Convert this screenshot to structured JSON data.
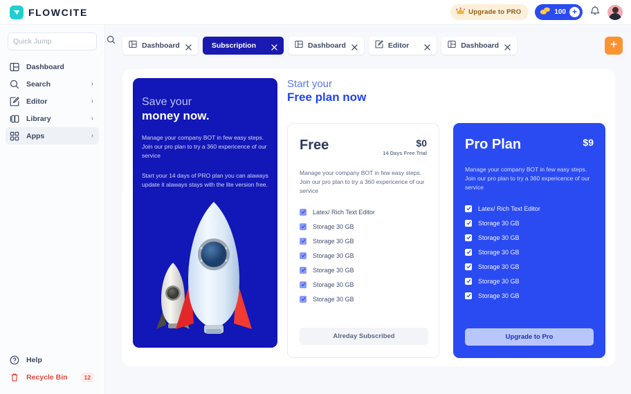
{
  "app": {
    "logo_text": "FLOWCITE",
    "logo_icon": "flowcite-logo-icon"
  },
  "topbar": {
    "upgrade_pill": {
      "label": "Upgrade to PRO",
      "icon": "crown-icon"
    },
    "coins_pill": {
      "count": "100",
      "icon": "coins-icon",
      "plus": "+"
    },
    "notifications_icon": "bell-icon",
    "avatar": "user-avatar"
  },
  "sidebar": {
    "search": {
      "placeholder": "Quick Jump",
      "value": "",
      "icon": "search-icon"
    },
    "items": [
      {
        "label": "Dashboard",
        "icon": "dashboard-icon",
        "chevron": "",
        "active": false
      },
      {
        "label": "Search",
        "icon": "search-icon",
        "chevron": "›",
        "active": false
      },
      {
        "label": "Editor",
        "icon": "editor-icon",
        "chevron": "›",
        "active": false
      },
      {
        "label": "Library",
        "icon": "library-icon",
        "chevron": "›",
        "active": false
      },
      {
        "label": "Apps",
        "icon": "apps-icon",
        "chevron": "›",
        "active": true
      }
    ],
    "bottom": [
      {
        "label": "Help",
        "icon": "help-circle-icon",
        "badge": ""
      },
      {
        "label": "Recycle Bin",
        "icon": "trash-icon",
        "badge": "12"
      }
    ]
  },
  "tabs": {
    "items": [
      {
        "label": "Dashboard",
        "icon": "dashboard-icon",
        "active": false
      },
      {
        "label": "Subscription",
        "icon": "",
        "active": true
      },
      {
        "label": "Dashboard",
        "icon": "dashboard-icon",
        "active": false
      },
      {
        "label": "Editor",
        "icon": "editor-icon",
        "active": false
      },
      {
        "label": "Dashboard",
        "icon": "dashboard-icon",
        "active": false
      }
    ],
    "close_icon": "close-icon",
    "add_tab": {
      "icon": "plus-icon",
      "color": "#fb9332"
    }
  },
  "promo": {
    "subtitle": "Save your",
    "title": "money now.",
    "paragraph1": "Manage your company BOT in few easy steps. Join our pro plan to try a 360 expericence of our service",
    "paragraph2": "Start your 14 days of PRO plan you can alaways update it alaways stays with the lite version free.",
    "illustration": "rockets-illustration",
    "bg_color": "#1217b7"
  },
  "plans": {
    "subtitle": "Start your",
    "title": "Free plan now",
    "free": {
      "name": "Free",
      "price": "$0",
      "price_note": "14 Days Free Trial",
      "description": "Manage your company BOT in few easy steps. Join our pro plan to try a 360 expericence of our service",
      "features": [
        "Latex/ Rich Text Editor",
        "Storage 30 GB",
        "Storage 30 GB",
        "Storage 30 GB",
        "Storage 30 GB",
        "Storage 30 GB",
        "Storage 30 GB"
      ],
      "cta": "Alreday Subscribed"
    },
    "pro": {
      "name": "Pro Plan",
      "price": "$9",
      "price_note": "",
      "description": "Manage your company BOT in few easy steps. Join our pro plan to try a 360 expericence of our service",
      "features": [
        "Latex/ Rich Text Editor",
        "Storage 30 GB",
        "Storage 30 GB",
        "Storage 30 GB",
        "Storage 30 GB",
        "Storage 30 GB",
        "Storage 30 GB"
      ],
      "cta": "Upgrade to Pro",
      "bg_color": "#2b4bf2"
    }
  }
}
